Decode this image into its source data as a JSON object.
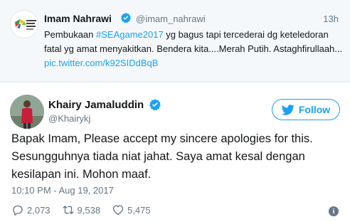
{
  "quoted_tweet": {
    "author_name": "Imam Nahrawi",
    "handle": "@imam_nahrawi",
    "time": "13h",
    "text_before_hashtag": "Pembukaan ",
    "hashtag": "#SEAgame2017",
    "text_after_hashtag": " yg bagus tapi tercederai dg keteledoran fatal yg amat menyakitkan. Bendera kita....Merah Putih. Astaghfirullaah... ",
    "link": "pic.twitter.com/k92SIDdBqB"
  },
  "tweet": {
    "author_name": "Khairy Jamaluddin",
    "handle": "@Khairykj",
    "follow_label": "Follow",
    "text": "Bapak Imam, Please accept my sincere apologies for this. Sesungguhnya tiada niat jahat. Saya amat kesal dengan kesilapan ini. Mohon maaf.",
    "timestamp": "10:10 PM - Aug 19, 2017",
    "replies": "2,073",
    "retweets": "9,538",
    "likes": "5,475"
  },
  "icons": {
    "verified": "verified-badge-icon",
    "follow": "twitter-bird-icon",
    "reply": "reply-bubble-icon",
    "retweet": "retweet-icon",
    "like": "heart-icon",
    "info": "info-icon"
  },
  "colors": {
    "accent": "#1da1f2",
    "muted": "#657786",
    "text": "#14171a",
    "quoted_bg": "#f5f8fa"
  }
}
